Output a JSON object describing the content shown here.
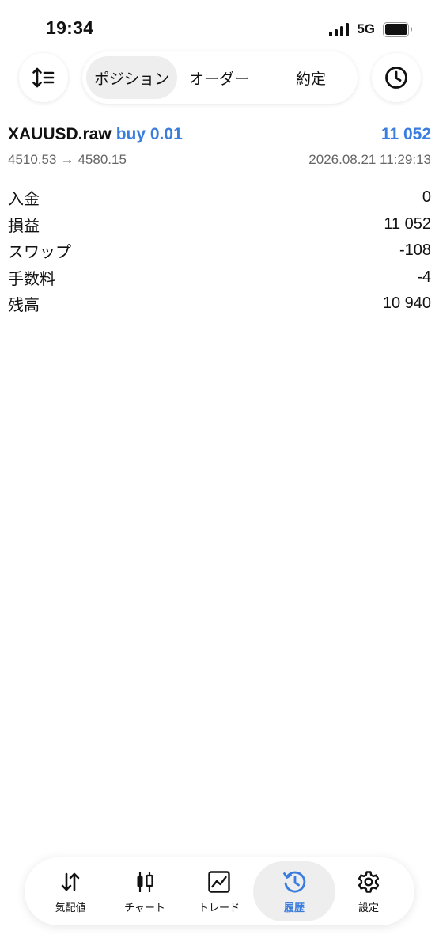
{
  "status_bar": {
    "time": "19:34",
    "network": "5G"
  },
  "toolbar": {
    "sort_icon": "sort-arrows-icon",
    "history_icon": "clock-icon",
    "tabs": [
      {
        "label": "ポジション",
        "active": true
      },
      {
        "label": "オーダー",
        "active": false
      },
      {
        "label": "約定",
        "active": false
      }
    ]
  },
  "deal": {
    "symbol": "XAUUSD.raw",
    "side": "buy 0.01",
    "profit": "11 052",
    "open_price": "4510.53",
    "arrow": "→",
    "close_price": "4580.15",
    "datetime": "2026.08.21 11:29:13"
  },
  "details": [
    {
      "label": "入金",
      "value": "0"
    },
    {
      "label": "損益",
      "value": "11 052"
    },
    {
      "label": "スワップ",
      "value": "-108"
    },
    {
      "label": "手数料",
      "value": "-4"
    },
    {
      "label": "残高",
      "value": "10 940"
    }
  ],
  "tabbar": {
    "items": [
      {
        "label": "気配値",
        "icon": "quotes-arrows-icon",
        "active": false
      },
      {
        "label": "チャート",
        "icon": "candlestick-chart-icon",
        "active": false
      },
      {
        "label": "トレード",
        "icon": "trade-chart-icon",
        "active": false
      },
      {
        "label": "履歴",
        "icon": "history-clock-icon",
        "active": true
      },
      {
        "label": "設定",
        "icon": "gear-icon",
        "active": false
      }
    ]
  },
  "colors": {
    "accent": "#3a7dde",
    "text": "#111111",
    "muted": "#666666",
    "active_bg": "#eeeeee"
  }
}
